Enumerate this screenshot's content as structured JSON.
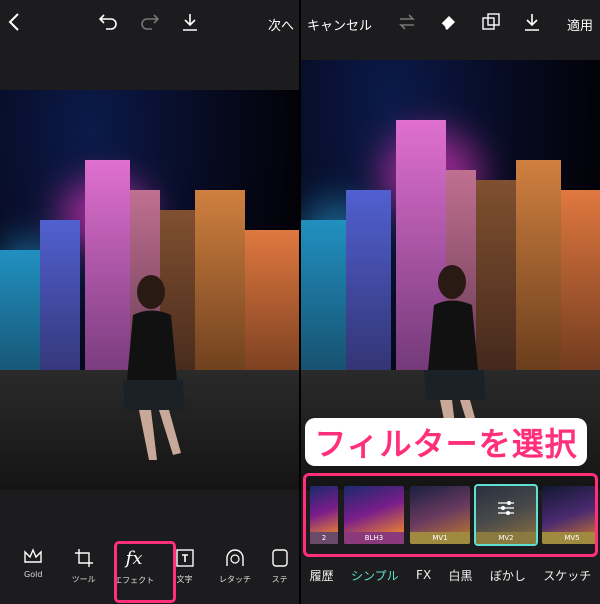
{
  "left": {
    "next_label": "次へ",
    "tools": [
      {
        "label": "Gold",
        "icon": "crown-icon"
      },
      {
        "label": "ツール",
        "icon": "crop-icon"
      },
      {
        "label": "エフェクト",
        "icon": "fx-icon"
      },
      {
        "label": "文字",
        "icon": "text-icon"
      },
      {
        "label": "レタッチ",
        "icon": "face-icon"
      },
      {
        "label": "ステ",
        "icon": "sticker-icon"
      }
    ]
  },
  "right": {
    "cancel_label": "キャンセル",
    "apply_label": "適用",
    "filters": [
      {
        "label": "2"
      },
      {
        "label": "BLH3"
      },
      {
        "label": "MV1"
      },
      {
        "label": "MV2"
      },
      {
        "label": "MV5"
      }
    ],
    "selected_filter": "MV2",
    "categories": [
      "履歴",
      "シンプル",
      "FX",
      "白黒",
      "ぼかし",
      "スケッチ"
    ],
    "active_category": "シンプル",
    "banner": "フィルターを選択"
  },
  "colors": {
    "highlight": "#ff2f7a",
    "accent": "#5fe0d0"
  }
}
